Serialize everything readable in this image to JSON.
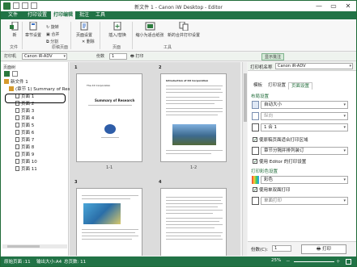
{
  "window": {
    "title": "新文件 1 - Canon iW Desktop - Editor",
    "controls": [
      "—",
      "▭",
      "✕"
    ]
  },
  "menu": {
    "tabs": [
      {
        "label": "文件",
        "active": false
      },
      {
        "label": "打印设置",
        "active": false
      },
      {
        "label": "打印编辑",
        "active": true
      },
      {
        "label": "批注",
        "active": false
      },
      {
        "label": "工具",
        "active": false
      }
    ]
  },
  "ribbon": {
    "new_doc": "新",
    "chapter_setting": "章节设置",
    "rotate": "旋转",
    "combine": "合并",
    "split": "分割",
    "page_setting": "页面设置",
    "delete": "删除",
    "insert_replace": "插入/替换",
    "zoom_fit": "缩小为适合纸张",
    "page_combine_setting": "新的合并打印设置",
    "groups": [
      "文件",
      "原稿页面",
      "页面",
      "工具"
    ]
  },
  "toolbar2": {
    "printer_label": "打印机",
    "printer_value": "Canon iR-ADV",
    "copies_label": "份数",
    "copies_value": "1",
    "print_label": "打印",
    "show_panel_label": "显示批注"
  },
  "left_panel": {
    "title": "页面树",
    "tree": [
      {
        "label": "新文件 1",
        "kind": "doc",
        "indent": 0
      },
      {
        "label": "(章节 1) Summary of Research",
        "kind": "chapter",
        "indent": 1
      },
      {
        "label": "页面 1",
        "kind": "page",
        "indent": 2
      },
      {
        "label": "页面 2",
        "kind": "page",
        "indent": 2
      },
      {
        "label": "页面 3",
        "kind": "page",
        "indent": 2
      },
      {
        "label": "页面 4",
        "kind": "page",
        "indent": 2
      },
      {
        "label": "页面 5",
        "kind": "page",
        "indent": 2
      },
      {
        "label": "页面 6",
        "kind": "page",
        "indent": 2
      },
      {
        "label": "页面 7",
        "kind": "page",
        "indent": 2
      },
      {
        "label": "页面 8",
        "kind": "page",
        "indent": 2
      },
      {
        "label": "页面 9",
        "kind": "page",
        "indent": 2
      },
      {
        "label": "页面 10",
        "kind": "page",
        "indent": 2
      },
      {
        "label": "页面 11",
        "kind": "page",
        "indent": 2
      }
    ]
  },
  "center": {
    "pages": [
      {
        "num": "1",
        "label": "1-1",
        "heading": "The XX Corporation",
        "title": "Summary of Research"
      },
      {
        "num": "2",
        "label": "1-2",
        "heading": "Introduction of XX Corporation",
        "title": ""
      },
      {
        "num": "3",
        "label": "",
        "heading": "",
        "title": ""
      },
      {
        "num": "4",
        "label": "",
        "heading": "",
        "title": ""
      }
    ]
  },
  "right_panel": {
    "header_label": "打印机名称",
    "printer_value": "Canon iR-ADV",
    "tabs": [
      "模板",
      "打印设置",
      "页面设置"
    ],
    "active_tab": "页面设置",
    "section_layout": "布局设置",
    "paper_size": "自动大小",
    "orientation": "纵向",
    "n_up": "1 合 1",
    "check_resize": "使原稿页面适合打印区域",
    "chapter_finish": "章节分隔并排列装订",
    "check_editor": "使用 Editor 的打印设置",
    "section_color": "打印彩色设置",
    "color_value": "彩色",
    "check_duplex": "使用单双面打印",
    "duplex_value": "单面打印",
    "copies_label": "份数(C):",
    "copies_value": "1",
    "print_button": "打印"
  },
  "status": {
    "print_pages": "原始页面 :11",
    "output_size": "输出大小:A4",
    "total_pages": "总页数: 11",
    "zoom": "25%"
  },
  "colors": {
    "accent": "#217346",
    "highlight": "#000000"
  }
}
